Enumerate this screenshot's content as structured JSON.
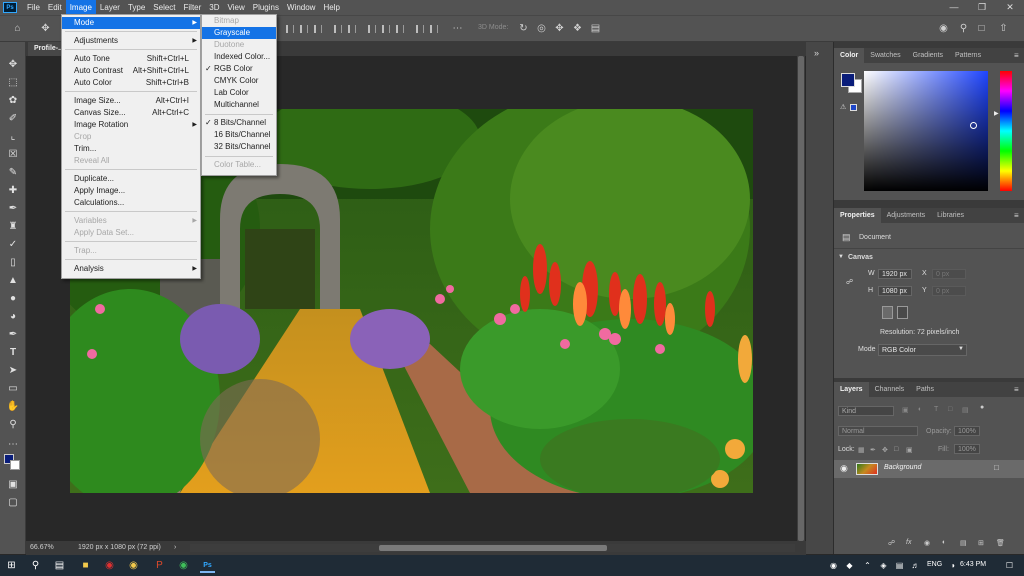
{
  "menubar": {
    "app_icon": "Ps",
    "items": [
      "File",
      "Edit",
      "Image",
      "Layer",
      "Type",
      "Select",
      "Filter",
      "3D",
      "View",
      "Plugins",
      "Window",
      "Help"
    ],
    "active": "Image"
  },
  "options_bar": {
    "mode_3d": "3D Mode:"
  },
  "doc_tab": {
    "title": "Profile-..."
  },
  "image_menu": [
    {
      "label": "Mode",
      "shortcut": "",
      "submenu": true,
      "highlight": true
    },
    {
      "sep": true
    },
    {
      "label": "Adjustments",
      "shortcut": "",
      "submenu": true
    },
    {
      "sep": true
    },
    {
      "label": "Auto Tone",
      "shortcut": "Shift+Ctrl+L"
    },
    {
      "label": "Auto Contrast",
      "shortcut": "Alt+Shift+Ctrl+L"
    },
    {
      "label": "Auto Color",
      "shortcut": "Shift+Ctrl+B"
    },
    {
      "sep": true
    },
    {
      "label": "Image Size...",
      "shortcut": "Alt+Ctrl+I"
    },
    {
      "label": "Canvas Size...",
      "shortcut": "Alt+Ctrl+C"
    },
    {
      "label": "Image Rotation",
      "shortcut": "",
      "submenu": true
    },
    {
      "label": "Crop",
      "shortcut": "",
      "disabled": true
    },
    {
      "label": "Trim...",
      "shortcut": ""
    },
    {
      "label": "Reveal All",
      "shortcut": "",
      "disabled": true
    },
    {
      "sep": true
    },
    {
      "label": "Duplicate...",
      "shortcut": ""
    },
    {
      "label": "Apply Image...",
      "shortcut": ""
    },
    {
      "label": "Calculations...",
      "shortcut": ""
    },
    {
      "sep": true
    },
    {
      "label": "Variables",
      "shortcut": "",
      "submenu": true,
      "disabled": true
    },
    {
      "label": "Apply Data Set...",
      "shortcut": "",
      "disabled": true
    },
    {
      "sep": true
    },
    {
      "label": "Trap...",
      "shortcut": "",
      "disabled": true
    },
    {
      "sep": true
    },
    {
      "label": "Analysis",
      "shortcut": "",
      "submenu": true
    }
  ],
  "mode_submenu": [
    {
      "label": "Bitmap",
      "disabled": true
    },
    {
      "label": "Grayscale",
      "highlight": true
    },
    {
      "label": "Duotone",
      "disabled": true
    },
    {
      "label": "Indexed Color..."
    },
    {
      "label": "RGB Color",
      "checked": true
    },
    {
      "label": "CMYK Color"
    },
    {
      "label": "Lab Color"
    },
    {
      "label": "Multichannel"
    },
    {
      "sep": true
    },
    {
      "label": "8 Bits/Channel",
      "checked": true
    },
    {
      "label": "16 Bits/Channel"
    },
    {
      "label": "32 Bits/Channel"
    },
    {
      "sep": true
    },
    {
      "label": "Color Table...",
      "disabled": true
    }
  ],
  "color_panel": {
    "tabs": [
      "Color",
      "Swatches",
      "Gradients",
      "Patterns"
    ],
    "foreground": "#0a1d7a",
    "background": "#ffffff",
    "hue": "#1f45ff"
  },
  "properties_panel": {
    "tabs": [
      "Properties",
      "Adjustments",
      "Libraries"
    ],
    "doc_label": "Document",
    "canvas_label": "Canvas",
    "w_label": "W",
    "w_value": "1920 px",
    "h_label": "H",
    "h_value": "1080 px",
    "x_label": "X",
    "x_placeholder": "0 px",
    "y_label": "Y",
    "y_placeholder": "0 px",
    "resolution": "Resolution: 72 pixels/inch",
    "mode_label": "Mode",
    "mode_value": "RGB Color"
  },
  "layers_panel": {
    "tabs": [
      "Layers",
      "Channels",
      "Paths"
    ],
    "kind_placeholder": "Kind",
    "blend_mode": "Normal",
    "opacity_label": "Opacity:",
    "opacity_value": "100%",
    "lock_label": "Lock:",
    "fill_label": "Fill:",
    "fill_value": "100%",
    "layer_name": "Background"
  },
  "status_bar": {
    "zoom": "66.67%",
    "doc_info": "1920 px x 1080 px (72 ppi)"
  },
  "taskbar": {
    "language": "ENG",
    "time": "6:43 PM"
  }
}
